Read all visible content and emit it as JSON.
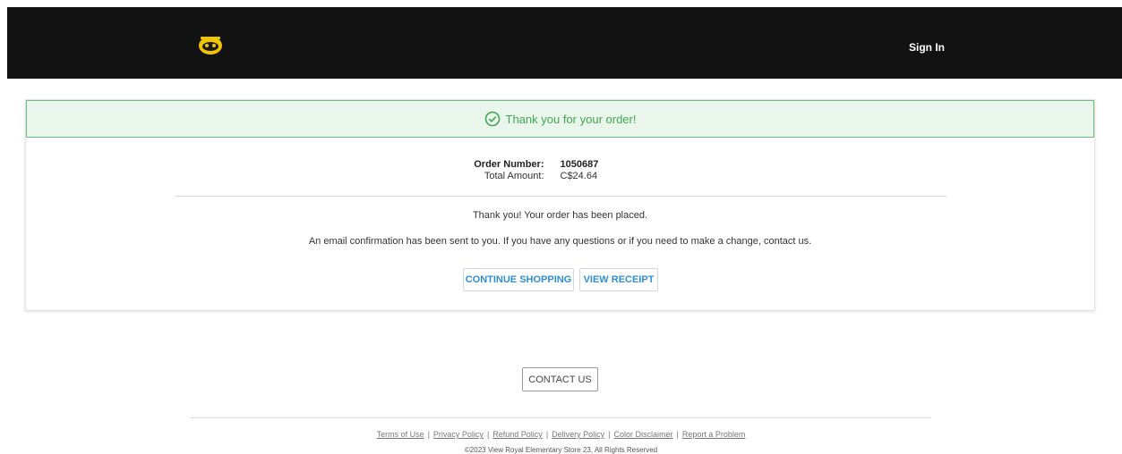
{
  "header": {
    "sign_in": "Sign In"
  },
  "banner": {
    "message": "Thank you for your order!",
    "color": "#3da84f"
  },
  "order": {
    "number_label": "Order Number:",
    "number_value": "1050687",
    "total_label": "Total Amount:",
    "total_value": "C$24.64"
  },
  "messages": {
    "placed": "Thank you! Your order has been placed.",
    "confirmation": "An email confirmation has been sent to you. If you have any questions or if you need to make a change, contact us."
  },
  "buttons": {
    "continue_shopping": "CONTINUE SHOPPING",
    "view_receipt": "VIEW RECEIPT",
    "contact_us": "CONTACT US"
  },
  "footer": {
    "links": [
      "Terms of Use",
      "Privacy Policy",
      "Refund Policy",
      "Delivery Policy",
      "Color Disclaimer",
      "Report a Problem"
    ],
    "copyright": "©2023 View Royal Elementary Store 23, All Rights Reserved"
  },
  "icons": {
    "logo": "raccoon-logo-icon",
    "banner": "check-circle-icon"
  }
}
